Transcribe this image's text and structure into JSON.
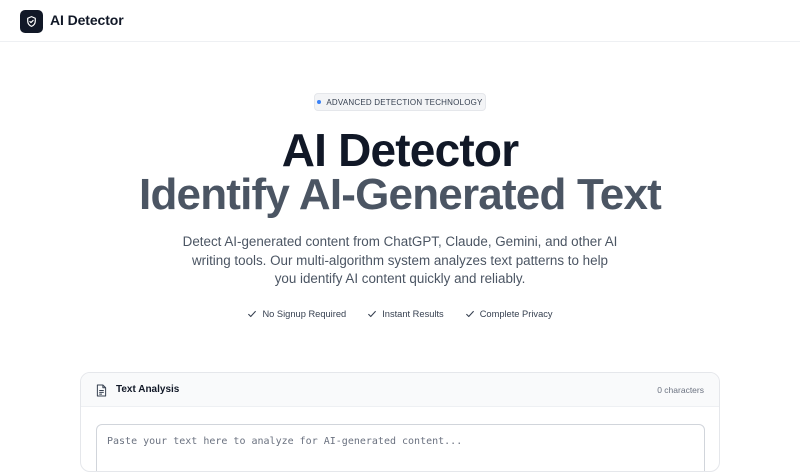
{
  "header": {
    "brand": "AI Detector",
    "logo_icon": "shield-icon"
  },
  "hero": {
    "badge": "ADVANCED DETECTION TECHNOLOGY",
    "title_line1": "AI Detector",
    "title_line2": "Identify AI-Generated Text",
    "description": "Detect AI-generated content from ChatGPT, Claude, Gemini, and other AI writing tools. Our multi-algorithm system analyzes text patterns to help you identify AI content quickly and reliably.",
    "features": [
      {
        "label": "No Signup Required",
        "icon": "check-icon"
      },
      {
        "label": "Instant Results",
        "icon": "check-icon"
      },
      {
        "label": "Complete Privacy",
        "icon": "check-icon"
      }
    ]
  },
  "analysis": {
    "title": "Text Analysis",
    "title_icon": "document-icon",
    "char_count": "0 characters",
    "input_value": "",
    "placeholder": "Paste your text here to analyze for AI-generated content..."
  },
  "colors": {
    "primary_text": "#111827",
    "secondary_title": "#4b5563",
    "accent_dot": "#3b82f6",
    "logo_bg": "#111827"
  }
}
